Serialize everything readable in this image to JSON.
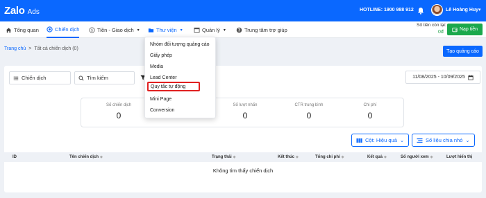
{
  "topbar": {
    "logo_main": "Zalo",
    "logo_sub": "Ads",
    "hotline": "HOTLINE: 1900 988 912",
    "username": "Lê Hoàng Huy",
    "bg_color": "#0a68ff"
  },
  "nav": {
    "items": [
      {
        "label": "Tổng quan",
        "icon": "home-icon"
      },
      {
        "label": "Chiến dịch",
        "icon": "target-icon"
      },
      {
        "label": "Tiền - Giao dịch",
        "icon": "money-icon"
      },
      {
        "label": "Thư viện",
        "icon": "folder-icon"
      },
      {
        "label": "Quản lý",
        "icon": "manage-icon"
      },
      {
        "label": "Trung tâm trợ giúp",
        "icon": "help-icon"
      }
    ],
    "balance_label": "Số tiền còn lại:",
    "balance_value": "0đ",
    "topup_label": "Nạp tiền"
  },
  "breadcrumb": {
    "home": "Trang chủ",
    "separator": ">",
    "current": "Tất cả chiến dịch (0)"
  },
  "create_button": "Tạo quảng cáo",
  "filters": {
    "campaign_label": "Chiến dịch",
    "search_placeholder": "Tìm kiếm",
    "date_range": "11/08/2025 - 10/09/2025"
  },
  "stats": [
    {
      "label": "Số chiến dịch",
      "value": "0"
    },
    {
      "label": "",
      "value": ""
    },
    {
      "label": "Số lượt nhấn",
      "value": "0"
    },
    {
      "label": "CTR trung bình",
      "value": "0"
    },
    {
      "label": "Chi phí",
      "value": "0"
    }
  ],
  "table_controls": {
    "columns_label": "Cột: Hiệu quả",
    "breakdown_label": "Số liệu chia nhỏ"
  },
  "table": {
    "headers": [
      "ID",
      "Tên chiến dịch",
      "Trạng thái",
      "Kết thúc",
      "Tổng chi phí",
      "Kết quả",
      "Số người xem",
      "Lượt hiển thị"
    ],
    "empty_text": "Không tìm thấy chiến dịch"
  },
  "dropdown": {
    "items": [
      "Nhóm đối tượng quảng cáo",
      "Giấy phép",
      "Media",
      "Lead Center",
      "Quy tắc tự động",
      "Mini Page",
      "Conversion"
    ],
    "highlighted_index": 4
  }
}
